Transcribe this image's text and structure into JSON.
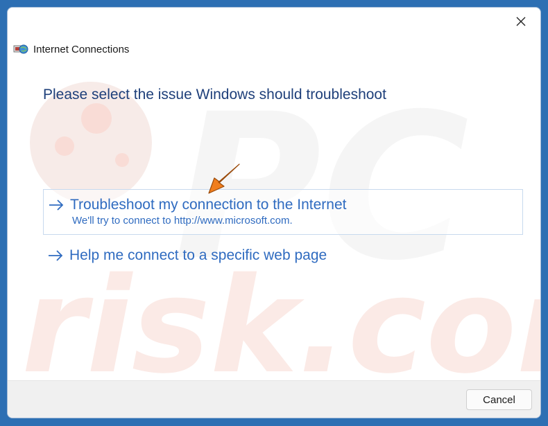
{
  "window": {
    "title": "Internet Connections",
    "close_icon": "close-icon",
    "app_icon": "network-connections-icon"
  },
  "main": {
    "heading": "Please select the issue Windows should troubleshoot",
    "options": [
      {
        "title": "Troubleshoot my connection to the Internet",
        "description": "We'll try to connect to http://www.microsoft.com.",
        "icon": "arrow-right-icon"
      },
      {
        "title": "Help me connect to a specific web page",
        "icon": "arrow-right-icon"
      }
    ]
  },
  "footer": {
    "cancel_label": "Cancel"
  },
  "colors": {
    "heading": "#1e3f7a",
    "link": "#2f6bc0",
    "annotation_arrow": "#f07e1e",
    "watermark": "#f6e3df"
  }
}
